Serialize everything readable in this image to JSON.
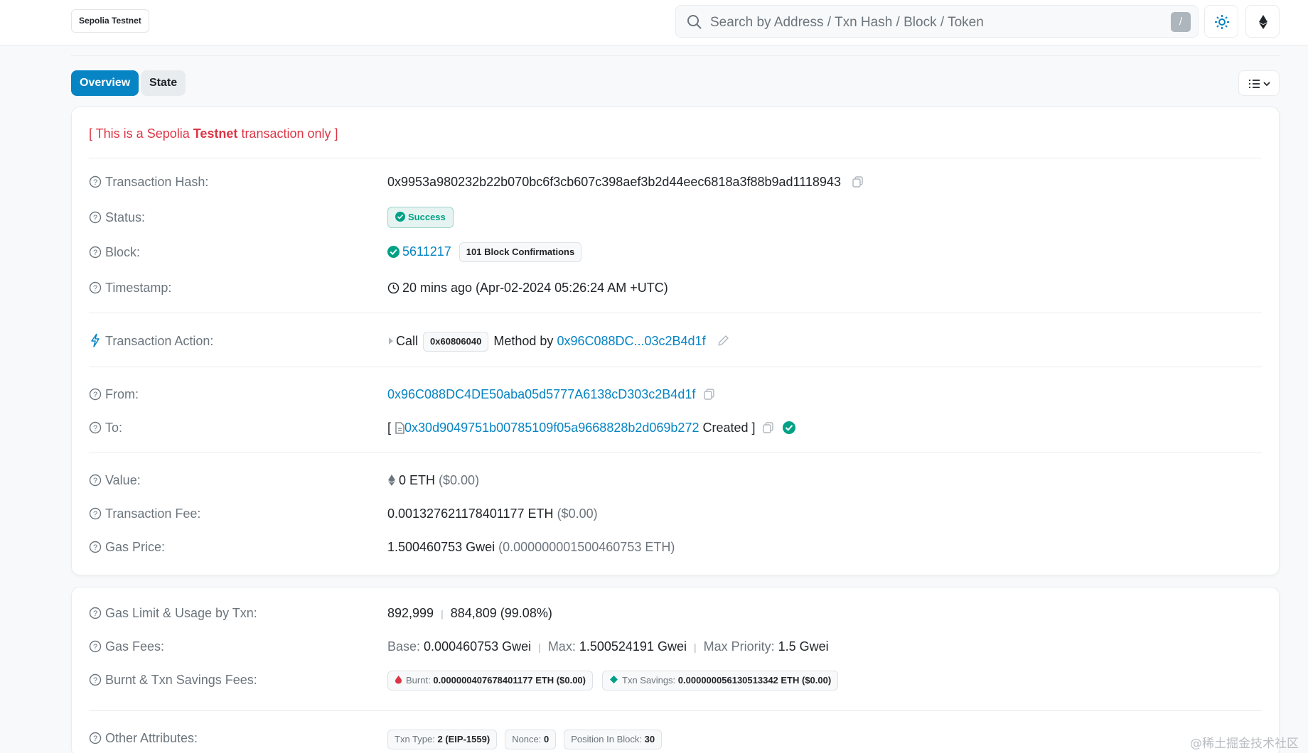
{
  "header": {
    "network_badge": "Sepolia Testnet",
    "search_placeholder": "Search by Address / Txn Hash / Block / Token",
    "search_shortcut": "/"
  },
  "tabs": [
    {
      "label": "Overview",
      "active": true
    },
    {
      "label": "State",
      "active": false
    }
  ],
  "notice": {
    "prefix": "[ This is a Sepolia ",
    "bold": "Testnet",
    "suffix": " transaction only ]"
  },
  "overview": {
    "tx_hash": {
      "label": "Transaction Hash:",
      "value": "0x9953a980232b22b070bc6f3cb607c398aef3b2d44eec6818a3f88b9ad1118943"
    },
    "status": {
      "label": "Status:",
      "value": "Success"
    },
    "block": {
      "label": "Block:",
      "value": "5611217",
      "confirmations": "101 Block Confirmations"
    },
    "timestamp": {
      "label": "Timestamp:",
      "value": "20 mins ago (Apr-02-2024 05:26:24 AM +UTC)"
    },
    "action": {
      "label": "Transaction Action:",
      "call": "Call",
      "method_id": "0x60806040",
      "method_by": "Method by",
      "caller": "0x96C088DC...03c2B4d1f"
    },
    "from": {
      "label": "From:",
      "value": "0x96C088DC4DE50aba05d5777A6138cD303c2B4d1f"
    },
    "to": {
      "label": "To:",
      "open": "[",
      "contract": "0x30d9049751b00785109f05a9668828b2d069b272",
      "created": "Created ]"
    },
    "value": {
      "label": "Value:",
      "amount": "0 ETH",
      "usd": "($0.00)"
    },
    "fee": {
      "label": "Transaction Fee:",
      "amount": "0.001327621178401177 ETH",
      "usd": "($0.00)"
    },
    "gas_price": {
      "label": "Gas Price:",
      "amount": "1.500460753 Gwei",
      "eth": "(0.000000001500460753 ETH)"
    }
  },
  "more": {
    "gas_limit": {
      "label": "Gas Limit & Usage by Txn:",
      "limit": "892,999",
      "sep": "|",
      "usage": "884,809 (99.08%)"
    },
    "gas_fees": {
      "label": "Gas Fees:",
      "base_label": "Base:",
      "base": "0.000460753 Gwei",
      "max_label": "Max:",
      "max": "1.500524191 Gwei",
      "priority_label": "Max Priority:",
      "priority": "1.5 Gwei"
    },
    "burnt": {
      "label": "Burnt & Txn Savings Fees:",
      "burnt_label": "Burnt:",
      "burnt_value": "0.000000407678401177 ETH ($0.00)",
      "savings_label": "Txn Savings:",
      "savings_value": "0.000000056130513342 ETH ($0.00)"
    },
    "other": {
      "label": "Other Attributes:",
      "txn_type_label": "Txn Type:",
      "txn_type": "2 (EIP-1559)",
      "nonce_label": "Nonce:",
      "nonce": "0",
      "position_label": "Position In Block:",
      "position": "30"
    }
  },
  "watermark": "@稀土掘金技术社区",
  "colors": {
    "accent": "#0784c3",
    "success": "#00a186",
    "danger": "#dc3545"
  }
}
